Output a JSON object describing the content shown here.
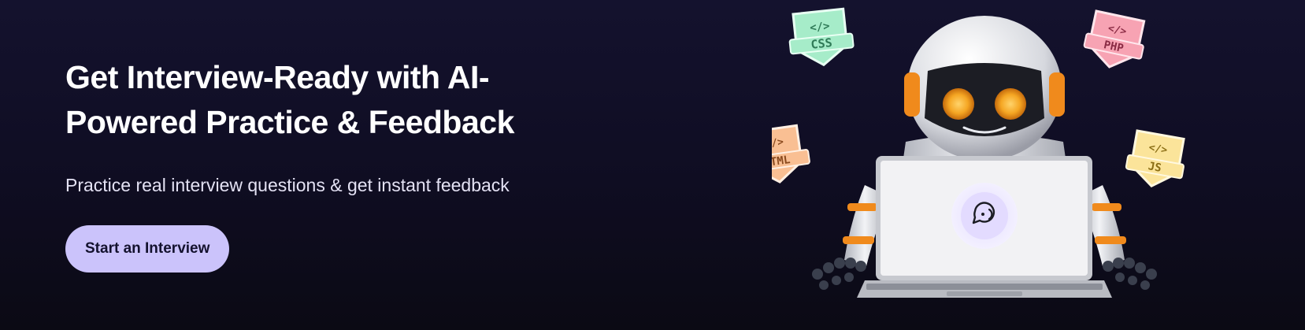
{
  "hero": {
    "headline_line1": "Get Interview-Ready with AI-",
    "headline_line2": "Powered Practice & Feedback",
    "subheadline": "Practice real interview questions & get instant feedback",
    "cta_label": "Start an Interview"
  },
  "illustration": {
    "badges": [
      {
        "label": "CSS",
        "icon": "code-brackets-icon",
        "color": "#a6ecc9",
        "ink": "#2f7a57"
      },
      {
        "label": "PHP",
        "icon": "code-brackets-icon",
        "color": "#f7a3b3",
        "ink": "#8a2b44"
      },
      {
        "label": "HTML",
        "icon": "code-brackets-icon",
        "color": "#f9bf93",
        "ink": "#8a4a1e"
      },
      {
        "label": "JS",
        "icon": "code-brackets-icon",
        "color": "#fbe49a",
        "ink": "#8a6d14"
      }
    ],
    "screen_icon": "chat-voice-icon"
  },
  "colors": {
    "background": "#14122e",
    "cta_background": "#cbc3fb",
    "cta_text": "#14122e",
    "robot_accent": "#f08a1c"
  }
}
